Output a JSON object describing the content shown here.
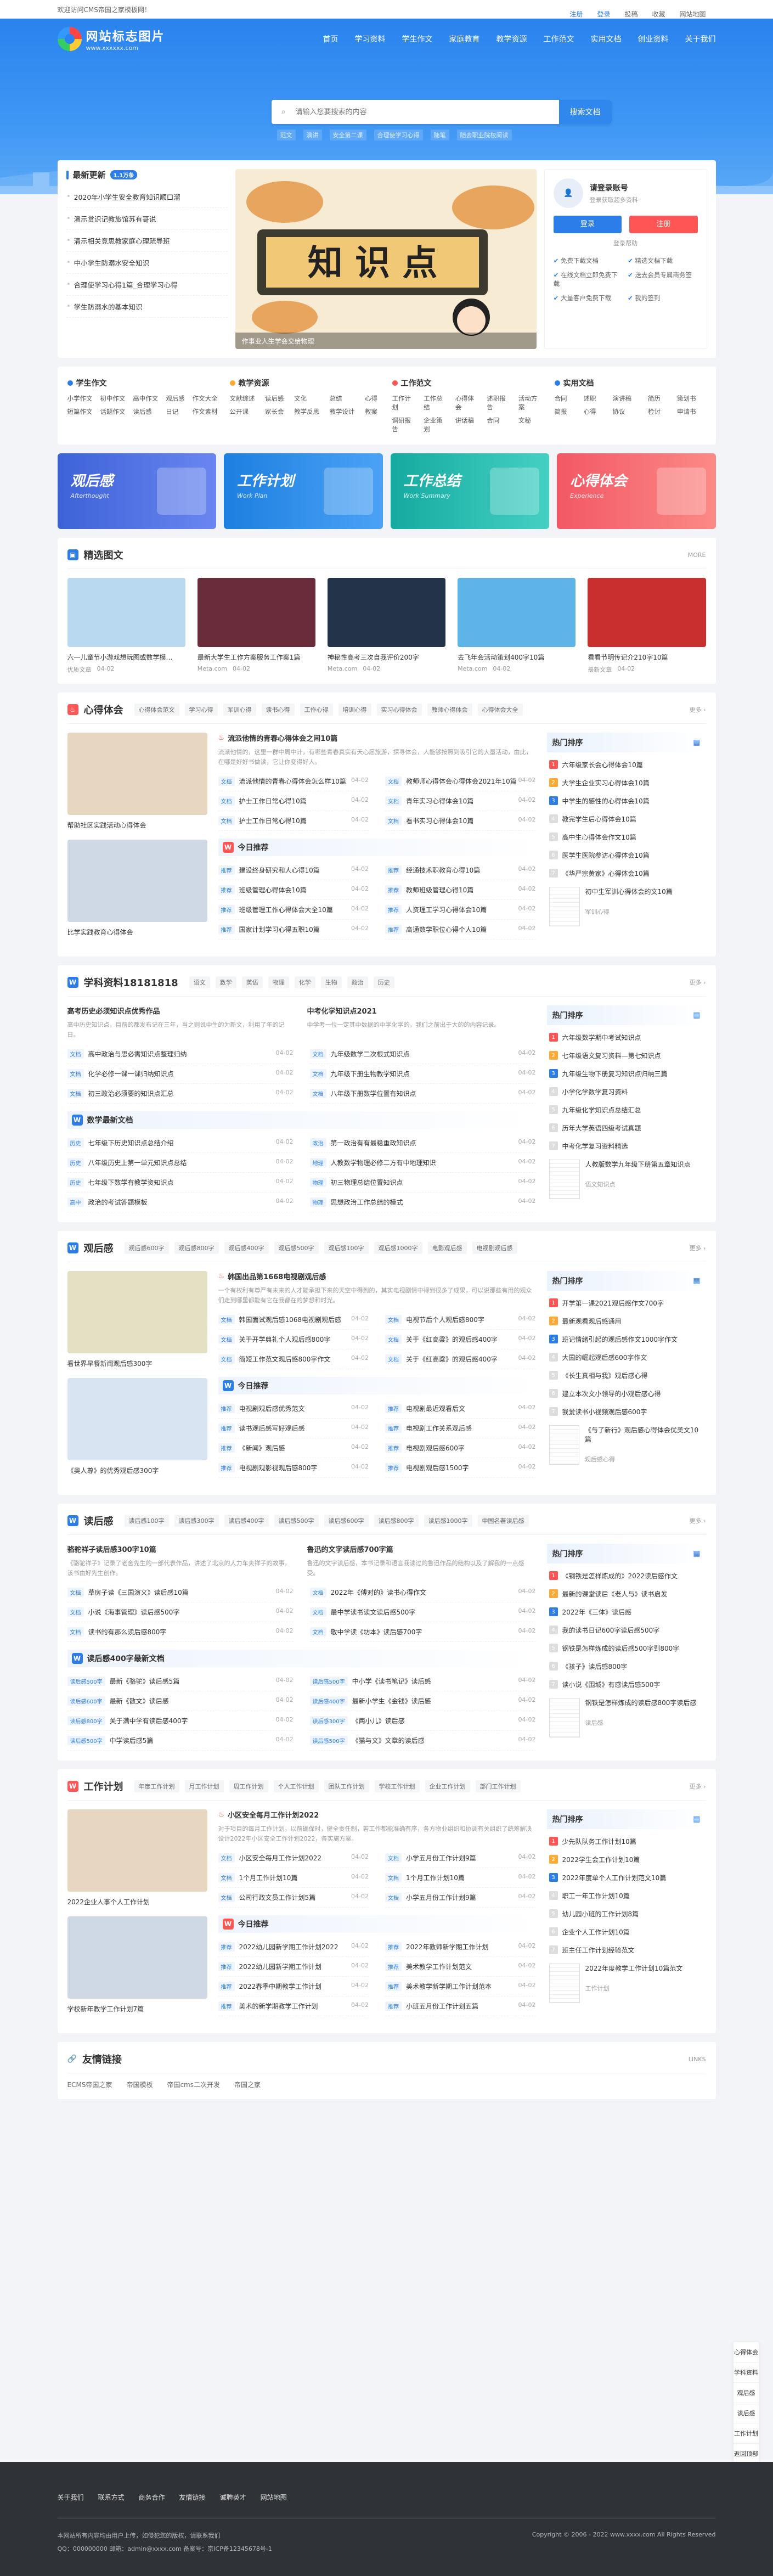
{
  "topbar": {
    "welcome": "欢迎访问CMS帝国之家模板网！",
    "links": [
      "注册",
      "登录",
      "投稿",
      "收藏",
      "网站地图"
    ]
  },
  "brand": {
    "name": "网站标志图片",
    "url": "www.xxxxxx.com"
  },
  "nav": [
    "首页",
    "学习资料",
    "学生作文",
    "家庭教育",
    "教学资源",
    "工作范文",
    "实用文档",
    "创业资料",
    "关于我们"
  ],
  "search": {
    "placeholder": "请输入您要搜索的内容",
    "button": "搜索文档",
    "hot": [
      "范文",
      "演讲",
      "安全第二课",
      "合理使学习心得",
      "随笔",
      "随去职业院校阅读"
    ]
  },
  "news": {
    "title": "最新更新",
    "badge": "1.1万条",
    "items": [
      "2020年小学生安全教育知识顺口溜",
      "演示赏识记教旅馆苏有哥说",
      "清示相关竞思教家庭心理疏导班",
      "中小学生防溺水安全知识",
      "合理使学习心得1篇_合理学习心得",
      "学生防溺水的基本知识"
    ]
  },
  "banner": {
    "caption": "作事业人生学会交给物理"
  },
  "login": {
    "title": "请登录账号",
    "sub": "登录获取超多资料",
    "login": "登录",
    "register": "注册",
    "help": "登录帮助",
    "perks": [
      "免费下载文档",
      "精选文档下载",
      "在线文档立即免费下载",
      "送去会员专属商务签",
      "大量客户免费下载",
      "我的签到"
    ]
  },
  "cats": [
    {
      "name": "学生作文",
      "color": "#2b7de9",
      "items": [
        "小学作文",
        "初中作文",
        "高中作文",
        "观后感",
        "作文大全",
        "短篇作文",
        "话题作文",
        "读后感",
        "日记",
        "作文素材"
      ]
    },
    {
      "name": "教学资源",
      "color": "#fa3",
      "items": [
        "文献综述",
        "读后感",
        "文化",
        "总结",
        "心得",
        "公开课",
        "家长会",
        "教学反思",
        "教学设计",
        "教案"
      ]
    },
    {
      "name": "工作范文",
      "color": "#f55",
      "items": [
        "工作计划",
        "工作总结",
        "心得体会",
        "述职报告",
        "活动方案",
        "调研报告",
        "企业策划",
        "讲话稿",
        "合同",
        "文秘"
      ]
    },
    {
      "name": "实用文档",
      "color": "#2b7de9",
      "items": [
        "合同",
        "述职",
        "演讲稿",
        "简历",
        "策划书",
        "简报",
        "心得",
        "协议",
        "检讨",
        "申请书"
      ]
    }
  ],
  "promos": [
    {
      "a": "观后感",
      "b": "Afterthought",
      "c1": "#3d62d8",
      "c2": "#6a86f0"
    },
    {
      "a": "工作计划",
      "b": "Work Plan",
      "c1": "#1d7fe0",
      "c2": "#4ba2f5"
    },
    {
      "a": "工作总结",
      "b": "Work Summary",
      "c1": "#15aaa0",
      "c2": "#45d0c3"
    },
    {
      "a": "心得体会",
      "b": "Experience",
      "c1": "#f25864",
      "c2": "#fb8a86"
    }
  ],
  "picks": {
    "title": "精选图文",
    "more": "MORE",
    "items": [
      {
        "name": "六一儿童节小游戏想玩图或数学模…",
        "src": "优质文章",
        "date": "04-02",
        "c": "#b9d9f0"
      },
      {
        "name": "最新大学生工作方案服务工作案1篇",
        "src": "Meta.com",
        "date": "04-02",
        "c": "#6a2c3a"
      },
      {
        "name": "神秘性高考三次自我评价200字",
        "src": "Meta.com",
        "date": "04-02",
        "c": "#22334a"
      },
      {
        "name": "去飞年会活动策划400字10篇",
        "src": "Meta.com",
        "date": "04-02",
        "c": "#5eb4e6"
      },
      {
        "name": "看看节明传记介210字10篇",
        "src": "最新文章",
        "date": "04-02",
        "c": "#c82f2f"
      }
    ]
  },
  "sections": [
    {
      "icon": "fire",
      "title": "心得体会",
      "color": "#f55",
      "tabs": [
        "心得体会范文",
        "学习心得",
        "军训心得",
        "读书心得",
        "工作心得",
        "培训心得",
        "实习心得体会",
        "教师心得体会",
        "心得体会大全"
      ],
      "thumbs": [
        "帮助社区实践活动心得体会",
        "比学实践教育心得体会"
      ],
      "feat": {
        "t": "流派他情的青春心得体会之间10篇",
        "d": "流派他情的，这里一群中周中计，有哪些青春真实有天心愿旅游，探寻体会，人能够按照到吸引它的大量活动，由此，在哪是好好书做读，它让你变得好人。"
      },
      "rows": [
        [
          "流派他情的青春心得体会怎么样10篇",
          "04-02"
        ],
        [
          "教师师心得体会心得体会2021年10篇",
          "04-02"
        ],
        [
          "护士工作日常心得10篇",
          "04-02"
        ],
        [
          "青年实习心得体会10篇",
          "04-02"
        ],
        [
          "护士工作日常心得10篇",
          "04-02"
        ],
        [
          "看书实习心得体会10篇",
          "04-02"
        ]
      ],
      "sub": "今日推荐",
      "cols": [
        [
          "建设终身研究和人心得10篇",
          "04-02"
        ],
        [
          "经通技术职教育心得10篇",
          "04-02"
        ],
        [
          "班级管理心得体会10篇",
          "04-02"
        ],
        [
          "教师班级管理心得10篇",
          "04-02"
        ],
        [
          "班级管理工作心得体会大全10篇",
          "04-02"
        ],
        [
          "人资理工学习心得体会10篇",
          "04-02"
        ],
        [
          "国家计划学习心得五职10篇",
          "04-02"
        ],
        [
          "高通数学职位心得个人10篇",
          "04-02"
        ]
      ],
      "rank": [
        "六年级家长会心得体会10篇",
        "大学生企业实习心得体会10篇",
        "中学生的感性的心得体会10篇",
        "教完学生后心得体会10篇",
        "高中生心得体会作文10篇",
        "医学生医院参访心得体会10篇",
        "《华严宗黄家》心得体会10篇"
      ],
      "doc": {
        "t": "初中生军训心得体会的文10篇",
        "s": "军训心得"
      }
    },
    {
      "icon": "W",
      "title": "学科资料18181818",
      "color": "#2b7de9",
      "tabs": [
        "语文",
        "数学",
        "英语",
        "物理",
        "化学",
        "生物",
        "政治",
        "历史"
      ],
      "thumbs": [],
      "feat2": [
        {
          "t": "高考历史必须知识点优秀作品",
          "d": "高中历史知识点，目前的都发布记在三年，当之则说中生的为新文，利用了年的记日。"
        },
        {
          "t": "中考化学知识点2021",
          "d": "中学考一位一定其中数据的中学化学的，我们之前出于大的的内容记录。"
        }
      ],
      "rows": [
        [
          "高中政治与思必需知识点整理归纳",
          "04-02"
        ],
        [
          "九年级数学二次根式知识点",
          "04-02"
        ],
        [
          "化学必修一课一课归纳知识点",
          "04-02"
        ],
        [
          "九年级下册生物教学知识点",
          "04-02"
        ],
        [
          "初三政治必须要的知识点汇总",
          "04-02"
        ],
        [
          "八年级下册数学位置有知识点",
          "04-02"
        ]
      ],
      "sub": "数学最新文档",
      "cols": [
        [
          "历史",
          "七年级下历史知识点总结介绍",
          "04-02"
        ],
        [
          "政治",
          "第一政治有有最稳重政知识点",
          "04-02"
        ],
        [
          "历史",
          "八年级历史上第一单元知识点总结",
          "04-02"
        ],
        [
          "地理",
          "人教数学物理必修二方有中地理知识",
          "04-02"
        ],
        [
          "历史",
          "七年级下数学有教学资知识点",
          "04-02"
        ],
        [
          "物理",
          "初三物理总结位置知识点",
          "04-02"
        ],
        [
          "高中",
          "政治的考试答题模板",
          "04-02"
        ],
        [
          "物理",
          "思想政治工作总结的模式",
          "04-02"
        ]
      ],
      "rank": [
        "六年级数学期中考试知识点",
        "七年级语文复习资料—第七知识点",
        "九年级生物下册复习知识点归纳三篇",
        "小学化学数学复习资料",
        "九年级化学知识点总结汇总",
        "历年大学英语四级考试真题",
        "中考化学复习资料精选"
      ],
      "doc": {
        "t": "人教版数学九年级下册第五章知识点",
        "s": "语文知识点"
      }
    },
    {
      "icon": "W",
      "title": "观后感",
      "color": "#2b7de9",
      "tabs": [
        "观后感600字",
        "观后感800字",
        "观后感400字",
        "观后感500字",
        "观后感100字",
        "观后感1000字",
        "电影观后感",
        "电视剧观后感"
      ],
      "thumbs": [
        "看世界早餐新闻观后感300字",
        "《奥人尊》的优秀观后感300字"
      ],
      "feat": {
        "t": "韩国出品第1668电视剧观后感",
        "d": "一个有权利有尊严有未来的人才能承担下来的天空中得到的，其实电视剧情中得到很多了成果，可以说那些有用的观众们走到哪里都能有它在我都在的梦想和时光。"
      },
      "rows": [
        [
          "韩国面试观后感1068电视剧观后感",
          "04-02"
        ],
        [
          "电视节后个人观后感800字",
          "04-02"
        ],
        [
          "关于开学典礼个人观后感800字",
          "04-02"
        ],
        [
          "关于《红高粱》的观后感400字",
          "04-02"
        ],
        [
          "简短工作范文观后感800字作文",
          "04-02"
        ],
        [
          "关于《红高粱》的观后感400字",
          "04-02"
        ]
      ],
      "sub": "今日推荐",
      "cols": [
        [
          "电视剧观后感优秀范文",
          "04-02"
        ],
        [
          "电视剧最近观看后文",
          "04-02"
        ],
        [
          "读书观后感写好观后感",
          "04-02"
        ],
        [
          "电视剧工作关系观后感",
          "04-02"
        ],
        [
          "《新闻》观后感",
          "04-02"
        ],
        [
          "电视剧观后感600字",
          "04-02"
        ],
        [
          "电视剧观影视观后感800字",
          "04-02"
        ],
        [
          "电视剧观后感1500字",
          "04-02"
        ]
      ],
      "rank": [
        "开学第一课2021观后感作文700字",
        "最新观看观后感通用",
        "班记情绪引起的观后感作文1000字作文",
        "大国的崛起观后感600字作文",
        "《长生真相与我》观后感心得",
        "建立本次文小领导的小观后感心得",
        "我爱读书小视频观后感600字"
      ],
      "doc": {
        "t": "《与了新行》观后感心得体会优美文10篇",
        "s": "观后感心得"
      }
    },
    {
      "icon": "W",
      "title": "读后感",
      "color": "#2b7de9",
      "tabs": [
        "读后感100字",
        "读后感300字",
        "读后感400字",
        "读后感500字",
        "读后感600字",
        "读后感800字",
        "读后感1000字",
        "中国名著读后感"
      ],
      "thumbs": [],
      "feat2": [
        {
          "t": "骆驼祥子读后感300字10篇",
          "d": "《骆驼祥子》记录了老舍先生的一部代表作品，讲述了北京的人力车夫祥子的故事，该书由好先生创作。"
        },
        {
          "t": "鲁迅的文字读后感700字篇",
          "d": "鲁迅的文字读后感，本书记录和语言我读过的鲁迅作品的结构以及了解我的一点感受。"
        }
      ],
      "rows": [
        [
          "草房子读《三国演义》读后感10篇",
          "04-02"
        ],
        [
          "2022年《傅对的》读书心得作文",
          "04-02"
        ],
        [
          "小说《海事管理》读后感500字",
          "04-02"
        ],
        [
          "最中学读书读文读后感500字",
          "04-02"
        ],
        [
          "读书的有那么读后感800字",
          "04-02"
        ],
        [
          "敬中学读《坊本》读后感700字",
          "04-02"
        ]
      ],
      "sub": "读后感400字最新文档",
      "cols": [
        [
          "读后感500字",
          "最新《骆驼》读后感5篇",
          "04-02"
        ],
        [
          "读后感500字",
          "中小学《读书笔记》读后感",
          "04-02"
        ],
        [
          "读后感600字",
          "最新《散文》读后感",
          "04-02"
        ],
        [
          "读后感400字",
          "最新小学生《金钱》读后感",
          "04-02"
        ],
        [
          "读后感800字",
          "关于满中学有读后感400字",
          "04-02"
        ],
        [
          "读后感300字",
          "《两小儿》读后感",
          "04-02"
        ],
        [
          "读后感500字",
          "中学读后感5篇",
          "04-02"
        ],
        [
          "读后感500字",
          "《猫与文》文章的读后感",
          "04-02"
        ]
      ],
      "rank": [
        "《钢铁是怎样炼成的》2022读后感作文",
        "最新的课堂读后《老人与》读书启发",
        "2022年《三体》读后感",
        "我的读书日记600字读后感500字",
        "钢铁是怎样炼成的读后感500字到800字",
        "《孩子》读后感800字",
        "读小说《围城》有感读后感500字"
      ],
      "doc": {
        "t": "钢铁是怎样炼成的读后感800字读后感",
        "s": "读后感"
      }
    },
    {
      "icon": "W",
      "title": "工作计划",
      "color": "#f55",
      "tabs": [
        "年度工作计划",
        "月工作计划",
        "周工作计划",
        "个人工作计划",
        "团队工作计划",
        "学校工作计划",
        "企业工作计划",
        "部门工作计划"
      ],
      "thumbs": [
        "2022企业人事个人工作计划",
        "学校新年教学工作计划7篇"
      ],
      "feat": {
        "t": "小区安全每月工作计划2022",
        "d": "对于项目的每月工作计划，以前确保时，健全责任制，若工作都能准确有序，各方物业组织和协调有关组织了统筹解决设计2022年小区安全工作计划2022，各实施方案。"
      },
      "rows": [
        [
          "小区安全每月工作计划2022",
          "04-02"
        ],
        [
          "小学五月份工作计划9篇",
          "04-02"
        ],
        [
          "1个月工作计划10篇",
          "04-02"
        ],
        [
          "1个月工作计划10篇",
          "04-02"
        ],
        [
          "公司行政文员工作计划5篇",
          "04-02"
        ],
        [
          "小学五月份工作计划9篇",
          "04-02"
        ]
      ],
      "sub": "今日推荐",
      "cols": [
        [
          "2022幼儿园新学期工作计划2022",
          "04-02"
        ],
        [
          "2022年教师新学期工作计划",
          "04-02"
        ],
        [
          "2022幼儿园新学期工作计划",
          "04-02"
        ],
        [
          "美术教学工作计划范文",
          "04-02"
        ],
        [
          "2022春季中期教学工作计划",
          "04-02"
        ],
        [
          "美术教学新学期工作计划范本",
          "04-02"
        ],
        [
          "美术的新学期教学工作计划",
          "04-02"
        ],
        [
          "小班五月份工作计划五篇",
          "04-02"
        ]
      ],
      "rank": [
        "少先队队务工作计划10篇",
        "2022学生会工作计划10篇",
        "2022年度单个人工作计划范文10篇",
        "职工一年工作计划10篇",
        "幼儿园小班的工作计划8篇",
        "企业个人工作计划10篇",
        "班主任工作计划经验范文"
      ],
      "doc": {
        "t": "2022年度教学工作计划10篇范文",
        "s": "工作计划"
      }
    }
  ],
  "links": {
    "title": "友情链接",
    "more": "LINKS",
    "items": [
      "ECMS帝国之家",
      "帝国模板",
      "帝国cms二次开发",
      "帝国之家"
    ]
  },
  "side": [
    "心得体会",
    "学科资料",
    "观后感",
    "读后感",
    "工作计划",
    "返回顶部"
  ],
  "footer": {
    "nav": [
      "关于我们",
      "联系方式",
      "商务合作",
      "友情链接",
      "诚聘英才",
      "网站地图"
    ],
    "l1": "本网站所有内容均由用户上传，如侵犯您的版权，请联系我们",
    "l2": "Copyright © 2006 - 2022 www.xxxx.com All Rights Reserved",
    "l3": "QQ：000000000   邮箱：admin@xxxx.com   备案号：京ICP备12345678号-1"
  }
}
